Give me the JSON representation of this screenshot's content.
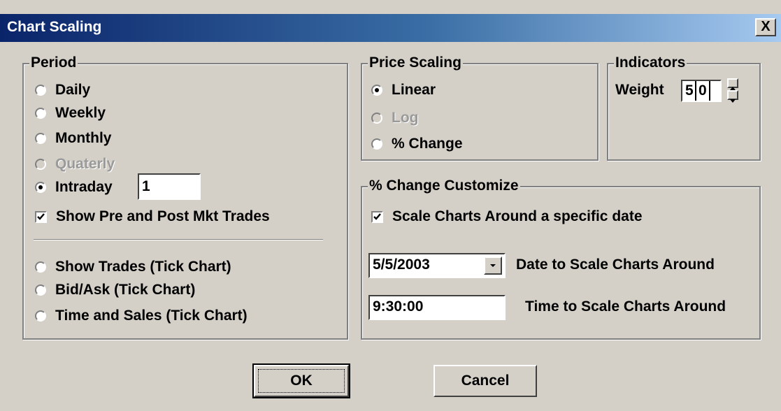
{
  "window": {
    "title": "Chart Scaling",
    "close_label": "X"
  },
  "period": {
    "title": "Period",
    "options": [
      {
        "label": "Daily",
        "checked": false,
        "disabled": false
      },
      {
        "label": "Weekly",
        "checked": false,
        "disabled": false
      },
      {
        "label": "Monthly",
        "checked": false,
        "disabled": false
      },
      {
        "label": "Quaterly",
        "checked": false,
        "disabled": true
      },
      {
        "label": "Intraday",
        "checked": true,
        "disabled": false
      }
    ],
    "intraday_value": "1",
    "show_pre_post_label": "Show Pre and Post Mkt Trades",
    "show_pre_post_checked": true,
    "tick_options": [
      {
        "label": "Show Trades (Tick Chart)",
        "checked": false
      },
      {
        "label": "Bid/Ask (Tick Chart)",
        "checked": false
      },
      {
        "label": "Time and Sales (Tick Chart)",
        "checked": false
      }
    ]
  },
  "price_scaling": {
    "title": "Price Scaling",
    "options": [
      {
        "label": "Linear",
        "checked": true,
        "disabled": false
      },
      {
        "label": "Log",
        "checked": false,
        "disabled": true
      },
      {
        "label": "% Change",
        "checked": false,
        "disabled": false
      }
    ]
  },
  "indicators": {
    "title": "Indicators",
    "weight_label": "Weight",
    "weight_digits": [
      "5",
      "0"
    ]
  },
  "change_customize": {
    "title": "% Change Customize",
    "scale_around_label": "Scale Charts Around a specific date",
    "scale_around_checked": true,
    "date_value": "5/5/2003",
    "date_label": "Date to Scale Charts Around",
    "time_value": "9:30:00",
    "time_label": "Time to Scale Charts Around"
  },
  "buttons": {
    "ok": "OK",
    "cancel": "Cancel"
  }
}
